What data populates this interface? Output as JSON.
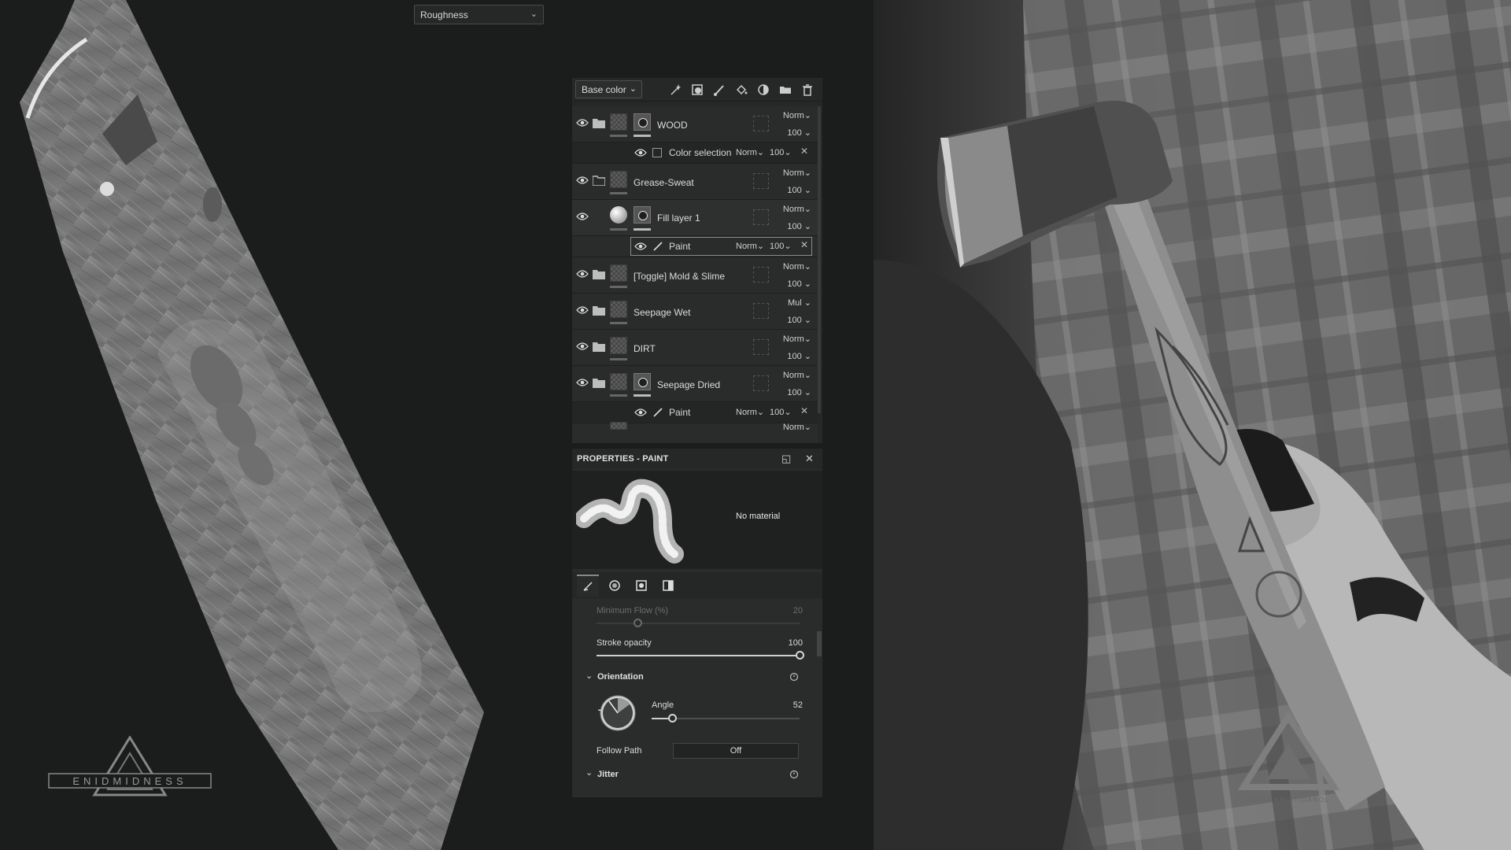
{
  "viewport": {
    "channel_select": "Roughness"
  },
  "layer_stack": {
    "channel_select": "Base color",
    "toolbar_icons": [
      "magic-wand-icon",
      "mask-icon",
      "paint-brush-icon",
      "fill-bucket-icon",
      "smart-material-icon",
      "folder-icon",
      "trash-icon"
    ],
    "layers": [
      {
        "name": "WOOD",
        "blend": "Norm",
        "opacity": "100",
        "type": "folder"
      },
      {
        "name": "Color selection",
        "blend": "Norm",
        "opacity": "100",
        "type": "effect"
      },
      {
        "name": "Grease-Sweat",
        "blend": "Norm",
        "opacity": "100",
        "type": "folder"
      },
      {
        "name": "Fill layer 1",
        "blend": "Norm",
        "opacity": "100",
        "type": "fill"
      },
      {
        "name": "Paint",
        "blend": "Norm",
        "opacity": "100",
        "type": "effect"
      },
      {
        "name": "[Toggle] Mold & Slime",
        "blend": "Norm",
        "opacity": "100",
        "type": "folder"
      },
      {
        "name": "Seepage Wet",
        "blend": "Mul",
        "opacity": "100",
        "type": "folder"
      },
      {
        "name": "DIRT",
        "blend": "Norm",
        "opacity": "100",
        "type": "folder"
      },
      {
        "name": "Seepage Dried",
        "blend": "Norm",
        "opacity": "100",
        "type": "folder"
      },
      {
        "name": "Paint",
        "blend": "Norm",
        "opacity": "100",
        "type": "effect"
      },
      {
        "name": "",
        "blend": "Norm",
        "opacity": "",
        "type": "folder"
      }
    ]
  },
  "properties": {
    "title": "PROPERTIES - PAINT",
    "material_label": "No material",
    "tabs": [
      "brush-icon",
      "alpha-icon",
      "stencil-icon",
      "material-icon"
    ],
    "min_flow_label": "Minimum Flow (%)",
    "min_flow_value": "20",
    "min_flow_fraction": 0.2,
    "stroke_opacity_label": "Stroke opacity",
    "stroke_opacity_value": "100",
    "stroke_opacity_fraction": 1.0,
    "orientation_label": "Orientation",
    "angle_label": "Angle",
    "angle_value": "52",
    "angle_fraction": 0.14,
    "follow_path_label": "Follow Path",
    "follow_path_value": "Off",
    "jitter_label": "Jitter"
  },
  "watermarks": {
    "left_logo": "ENIDMIDNESS",
    "right_logo": "DIANA KRISTIDAROL"
  }
}
